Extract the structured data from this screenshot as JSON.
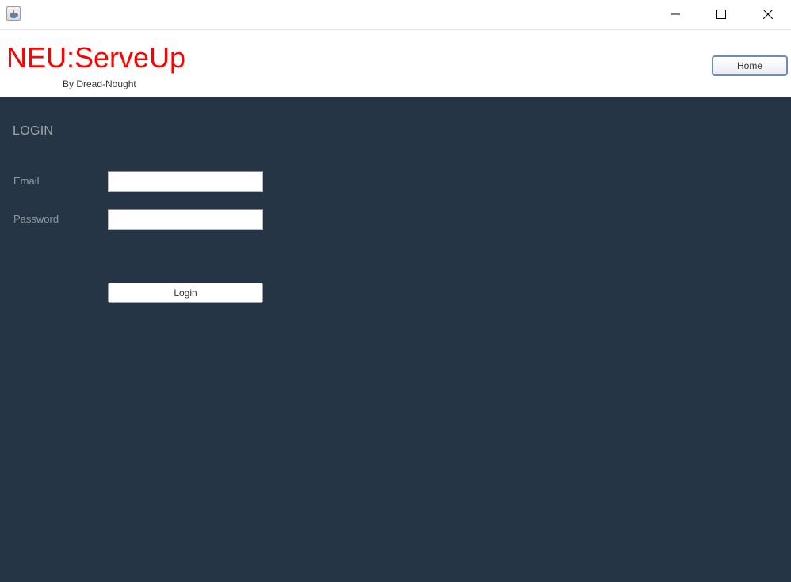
{
  "titlebar": {
    "app_icon": "java-cup-icon",
    "buttons": {
      "minimize_icon": "minimize-icon",
      "maximize_icon": "maximize-icon",
      "close_icon": "close-icon"
    }
  },
  "header": {
    "brand": "NEU:ServeUp",
    "byline": "By Dread-Nought",
    "home_button": "Home",
    "brand_color": "#ff0000"
  },
  "login": {
    "title": "LOGIN",
    "email_label": "Email",
    "email_value": "",
    "password_label": "Password",
    "password_value": "",
    "submit_label": "Login",
    "panel_color": "#263545"
  }
}
